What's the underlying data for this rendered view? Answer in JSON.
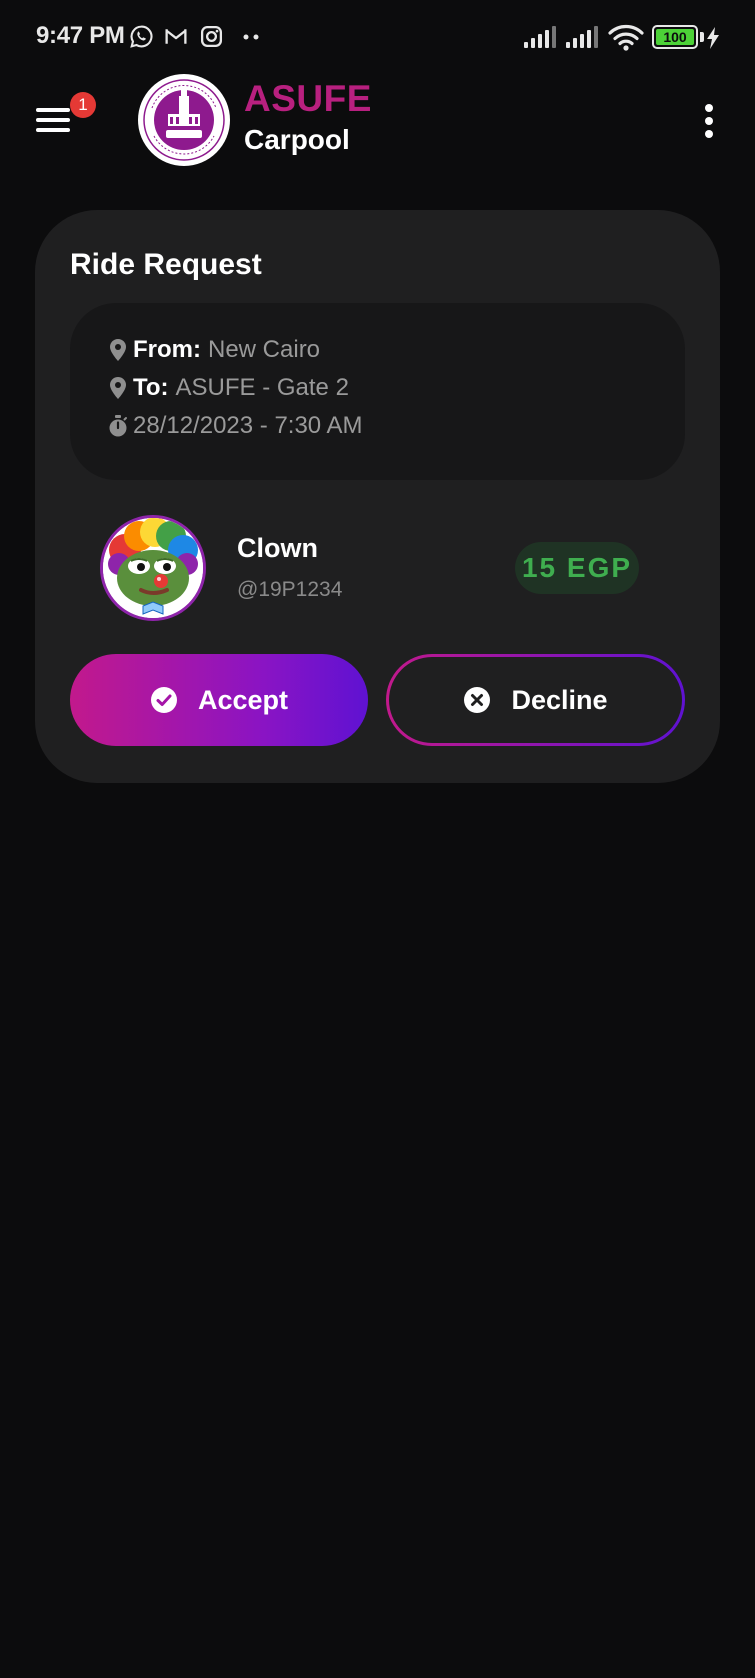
{
  "status_bar": {
    "time": "9:47 PM",
    "notification_icons": [
      "whatsapp-icon",
      "gmail-icon",
      "instagram-icon",
      "more-dots-icon"
    ],
    "battery_level": "100",
    "charging": true
  },
  "app_bar": {
    "notification_count": "1",
    "title": "ASUFE",
    "subtitle": "Carpool",
    "title_color": "#b8207f"
  },
  "ride_request": {
    "title": "Ride Request",
    "from_label": "From:",
    "from_value": "New Cairo",
    "to_label": "To:",
    "to_value": "ASUFE - Gate 2",
    "datetime": "28/12/2023 - 7:30 AM",
    "rider": {
      "name": "Clown",
      "handle": "@19P1234"
    },
    "price": "15 EGP",
    "accept_label": "Accept",
    "decline_label": "Decline"
  },
  "colors": {
    "background": "#0c0c0d",
    "card": "#1f1f20",
    "accent_pink": "#c2198c",
    "accent_purple": "#5f12d2",
    "price_green": "#3fae4f"
  }
}
